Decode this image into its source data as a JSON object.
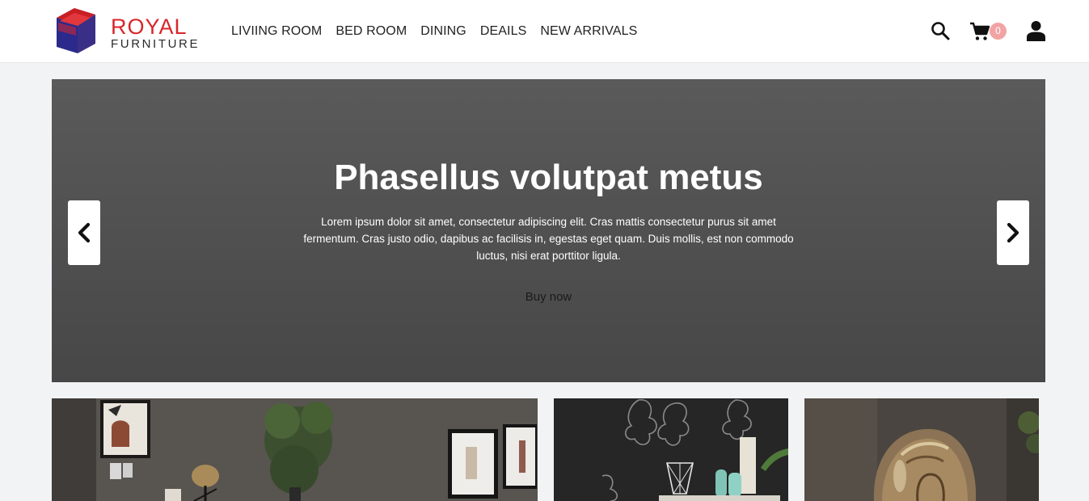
{
  "brand": {
    "name_line1": "ROYAL",
    "name_line2": "FURNITURE",
    "colors": {
      "red": "#d8262b",
      "navy": "#2b2a8c"
    }
  },
  "nav": {
    "items": [
      {
        "label": "LIVIING ROOM"
      },
      {
        "label": "BED ROOM"
      },
      {
        "label": "DINING"
      },
      {
        "label": "DEAILS"
      },
      {
        "label": "NEW ARRIVALS"
      }
    ]
  },
  "header_icons": {
    "search": "search-icon",
    "cart": "cart-icon",
    "user": "user-icon",
    "cart_count": "0",
    "badge_color": "#f2a3a3"
  },
  "hero": {
    "title": "Phasellus volutpat metus",
    "text": "Lorem ipsum dolor sit amet, consectetur adipiscing elit. Cras mattis consectetur purus sit amet fermentum. Cras justo odio, dapibus ac facilisis in, egestas eget quam. Duis mollis, est non commodo luctus, nisi erat porttitor ligula.",
    "button_label": "Buy now",
    "prev_icon": "chevron-left-icon",
    "next_icon": "chevron-right-icon",
    "background": "#525252"
  },
  "tiles": [
    {
      "icon": "living-room-image"
    },
    {
      "icon": "shelf-decor-image"
    },
    {
      "icon": "glass-lamp-image"
    }
  ]
}
